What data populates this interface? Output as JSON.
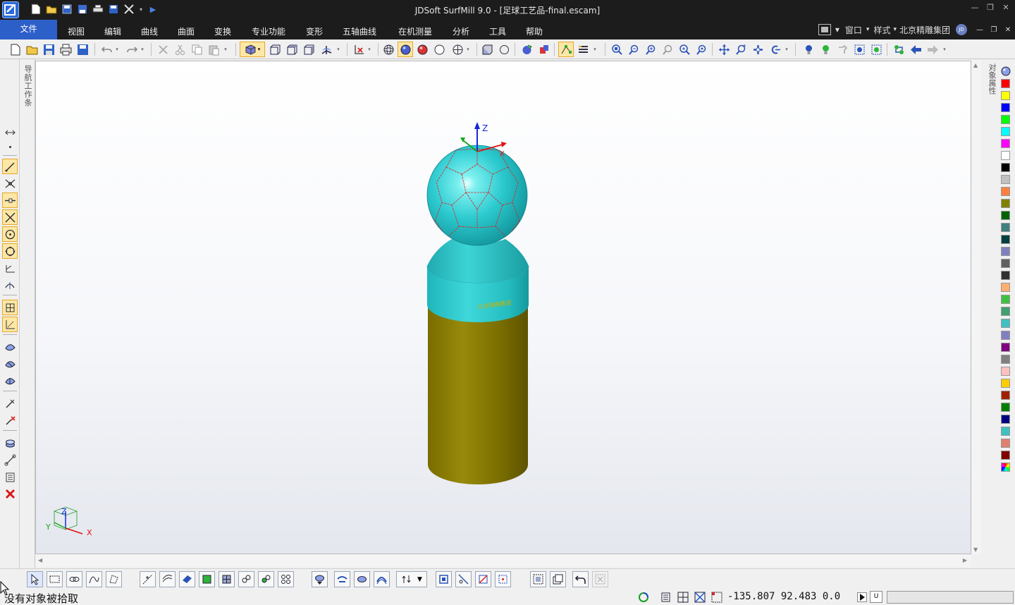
{
  "window": {
    "title": "JDSoft SurfMill 9.0 - [足球工艺品-final.escam]"
  },
  "menu": {
    "file": "文件",
    "items": [
      "视图",
      "编辑",
      "曲线",
      "曲面",
      "变换",
      "专业功能",
      "变形",
      "五轴曲线",
      "在机测量",
      "分析",
      "工具",
      "帮助"
    ],
    "right": {
      "window_menu": "窗口",
      "style_menu": "样式",
      "company": "北京精雕集团",
      "avatar": "JD"
    }
  },
  "panels": {
    "left_tab": "导航工作条",
    "right_tab": "对象属性"
  },
  "viewport": {
    "axis_labels": {
      "z": "Z",
      "x": "X",
      "y": "Y"
    },
    "engraving": "北京精雕集团"
  },
  "palette": [
    "#ff0000",
    "#ffff00",
    "#0000ff",
    "#00ff00",
    "#00ffff",
    "#ff00ff",
    "#ffffff",
    "#000000",
    "#c0c0c0",
    "#ff8040",
    "#808000",
    "#006400",
    "#408080",
    "#004040",
    "#8080c0",
    "#606060",
    "#303030",
    "#ffb070",
    "#40c040",
    "#40a070",
    "#40c0c0",
    "#8080c0",
    "#800080",
    "#808080",
    "#ffc0c0",
    "#ffcc00",
    "#a02000",
    "#008000",
    "#000080",
    "#40c0c0",
    "#e08070",
    "#800000"
  ],
  "status": {
    "message": "没有对象被拾取",
    "coords": "-135.807  92.483  0.0",
    "unit_button": "U"
  }
}
